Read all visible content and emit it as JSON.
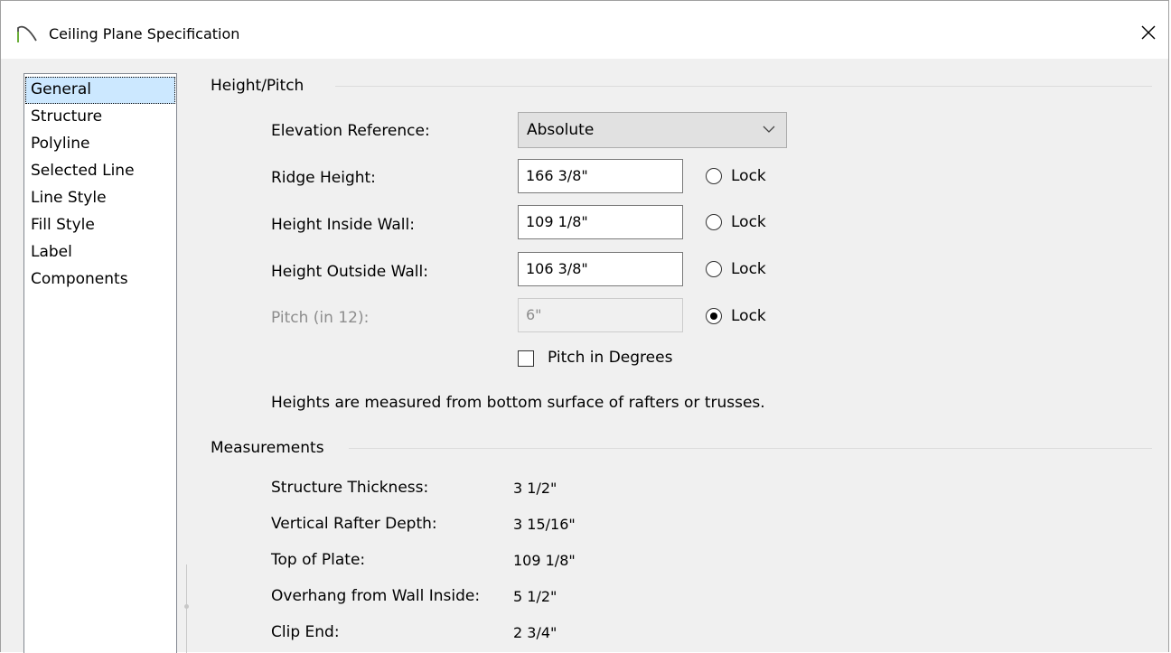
{
  "window": {
    "title": "Ceiling Plane Specification",
    "close_glyph": "✕"
  },
  "sidebar": {
    "items": [
      {
        "label": "General",
        "selected": true
      },
      {
        "label": "Structure"
      },
      {
        "label": "Polyline"
      },
      {
        "label": "Selected Line"
      },
      {
        "label": "Line Style"
      },
      {
        "label": "Fill Style"
      },
      {
        "label": "Label"
      },
      {
        "label": "Components"
      }
    ]
  },
  "height_pitch": {
    "group_title": "Height/Pitch",
    "elevation_reference": {
      "label": "Elevation Reference:",
      "value": "Absolute"
    },
    "ridge_height": {
      "label": "Ridge Height:",
      "value": "166 3/8\"",
      "lock_label": "Lock",
      "locked": false
    },
    "height_inside_wall": {
      "label": "Height Inside Wall:",
      "value": "109 1/8\"",
      "lock_label": "Lock",
      "locked": false
    },
    "height_outside_wall": {
      "label": "Height Outside Wall:",
      "value": "106 3/8\"",
      "lock_label": "Lock",
      "locked": false
    },
    "pitch": {
      "label": "Pitch (in 12):",
      "value": "6\"",
      "lock_label": "Lock",
      "locked": true,
      "disabled": true
    },
    "pitch_in_degrees": {
      "label": "Pitch in Degrees",
      "checked": false
    },
    "note": "Heights are measured from bottom surface of rafters or trusses."
  },
  "measurements": {
    "group_title": "Measurements",
    "rows": [
      {
        "label": "Structure Thickness:",
        "value": "3 1/2\""
      },
      {
        "label": "Vertical Rafter Depth:",
        "value": "3 15/16\""
      },
      {
        "label": "Top of Plate:",
        "value": "109 1/8\""
      },
      {
        "label": "Overhang from Wall Inside:",
        "value": "5 1/2\""
      },
      {
        "label": "Clip End:",
        "value": "2 3/4\""
      }
    ]
  },
  "icons": {
    "app": "ceiling-plane-icon",
    "close": "close-icon",
    "dropdown": "chevron-down-icon"
  }
}
